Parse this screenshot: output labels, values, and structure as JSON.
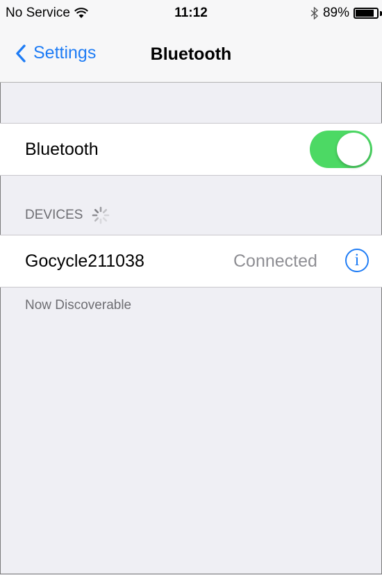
{
  "status_bar": {
    "carrier": "No Service",
    "time": "11:12",
    "battery_percent": "89%",
    "battery_level": 0.89,
    "wifi_icon": "wifi-icon",
    "bluetooth_icon": "bluetooth-icon"
  },
  "nav": {
    "back_label": "Settings",
    "title": "Bluetooth"
  },
  "bluetooth_toggle": {
    "label": "Bluetooth",
    "on": true,
    "color": "#4cd964"
  },
  "devices_section": {
    "header": "DEVICES",
    "spinner_icon": "loading-spinner-icon",
    "items": [
      {
        "name": "Gocycle211038",
        "status": "Connected",
        "info_icon": "info-icon"
      }
    ]
  },
  "footer_text": "Now Discoverable",
  "accent_color": "#1e7cf5"
}
